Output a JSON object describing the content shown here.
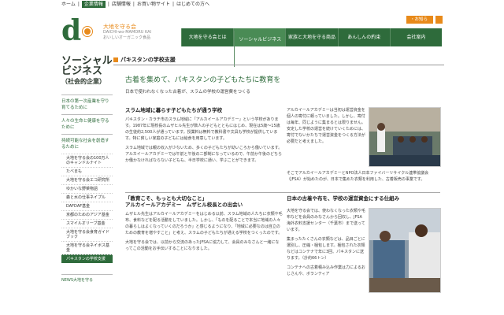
{
  "topnav": {
    "items": [
      "ホーム",
      "企業情報",
      "店舗情報",
      "お買い物サイト",
      "はじめての方へ"
    ],
    "active_index": 1
  },
  "logo": {
    "letter": "d",
    "title": "大地を守る会",
    "romaji": "DAICHI-wo-MAMORU KAI",
    "tagline": "おいしいオーガニック食品"
  },
  "notices": {
    "news": "・お知らせ",
    "recruit": "・お問い合わせ"
  },
  "mainnav": {
    "items": [
      "大地を守る会とは",
      "ソーシャルビジネス",
      "家族と大地を守る商品",
      "あんしんの約束",
      "会社案内"
    ],
    "active_sub": "（社会的企業）",
    "active_index": 1
  },
  "sidebar": {
    "title_line1": "ソーシャル",
    "title_line2": "ビジネス",
    "title_line3": "（社会的企業）",
    "items": [
      "日本の第一次産業を守り育てるために",
      "人々の生命と健康を守るために",
      "持続可能な社会を創造するために"
    ],
    "subitems": [
      "大地を守る会の100万人のキャンドルナイト",
      "たべまも",
      "大地を守る会エコ研究所",
      "ゆかいな野菜物語",
      "森と水の仕事ネイプル",
      "DAFDAF基金",
      "京都のためのアジア基金",
      "スマイルオリーブ基金",
      "大地を守る会食育ガイドブック",
      "大地を守る会ネイボス基金",
      "パキスタンの学校支援"
    ],
    "active_sub_index": 10,
    "bottom_link": "NEWS大地を守る"
  },
  "page": {
    "title": "パキスタンの学校支援",
    "headline": "古着を集めて、パキスタンの子どもたちに教育を",
    "lead": "日本で使われなくなった古着が、スラムの学校の運営費をつくる"
  },
  "section1": {
    "heading": "スラム地域に暮らす子どもたちが通う学校",
    "para1": "パキスタン・カラチ市のスラム地域に「アルカイールアカデミー」という学校があります。1987年に現校長のムザヒル先生が数人の子どもとともにはじめ、現在は5歳〜15歳の生徒約2,500人が通っています。授業料は無料で教科書や文具も学校が提供しています。特に貧しい家庭の子どもには給食を用意しています。",
    "para2": "スラム地域では親の収入が少ないため、多くの子どもたちが幼いころから働いています。アルカイールアカデミーでは午前と午後の二部制になっているので、午前か午後のどちらか働かなければならない子どもも、半日学校に通い、学ぶことができます。"
  },
  "section1_right": {
    "para1": "アルカイールアカデミーは当初は運営資金を個人の寄付に頼っていました。しかし、寄付は毎年、同じように集まるとは限りません。安定した学校の運営を続けていくためには、寄付でないかたちで運営資金をつくる方法が必要だと考えました。",
    "para2": "そこでアルカイールアカデミーとNPO法人日本ファイバーリサイクル連帯協議会（JFSA）が始めたのが、日本で集めた衣類を利用した、古着販売の事業です。"
  },
  "section2": {
    "heading1": "「教育こそ、もっとも大切なこと」",
    "heading2": "アルカイールアカデミー　ムザヒル校長との出会い",
    "para1": "ムザヒル先生はアルカイールアカデミーをはじめる以前、スラム地域の人たちに衣類や毛布、食料などを配る活動をしていました。しかし、「ものを配ることで本当に地域の人々の暮らしはよくなっていくのだろうか」と感じるようになり、「地域に必要なのは自立のための教育を増やすこと」と考え、スラムの子どもたちが通える学校をつくったのです。",
    "para2": "大地を守る会では、以前から交流のあったJFSAに協力して、会員のみなさんと一緒になってこの活動をお手伝いすることになりました。"
  },
  "section2_right": {
    "heading": "日本の古着や布を、学校の運営資金にする仕組み",
    "para1": "大地を守る会では、使わなくなった衣類や毛布などを会員のみなさんから回収し、JFSA海外衣料支援センター（千葉市）まで送っています。",
    "para2": "集まったたくさんの衣類などは、品目ごとに選別し、圧縮・梱包します。梱包された衣類などはコンテナで年に3回、パキスタンに送ります。（計約66トン）",
    "para3": "コンテナへの古着積み込み作業は力によるおじさんや、ボランティア"
  },
  "colors": {
    "green": "#2e6b3b",
    "orange": "#e88a1a"
  }
}
